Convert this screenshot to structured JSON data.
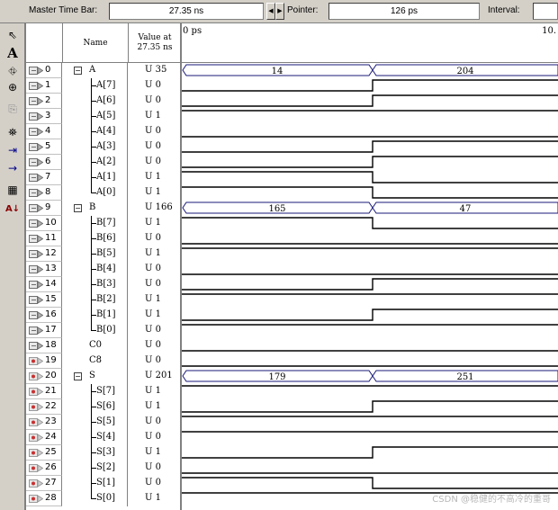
{
  "topbar": {
    "master_time_bar_label": "Master Time Bar:",
    "master_time_bar_value": "27.35 ns",
    "pointer_label": "Pointer:",
    "pointer_value": "126 ps",
    "interval_label": "Interval:",
    "interval_value": ""
  },
  "toolbar": {
    "tools": [
      "selection-tool-icon",
      "text-tool-icon",
      "waveform-editing-tool-icon",
      "zoom-tool-icon",
      "copy-icon",
      "find-icon",
      "replace-icon",
      "next-transition-icon",
      "group-icon",
      "sort-icon"
    ]
  },
  "grid": {
    "header_name": "Name",
    "header_value": "Value at\n27.35 ns"
  },
  "timeline": {
    "start_label": "0 ps",
    "end_label": "10."
  },
  "signals": [
    {
      "id": "0",
      "name": "A",
      "group": true,
      "value": "U 35",
      "pin": "input",
      "wave": "bus",
      "values": [
        "14",
        "204"
      ]
    },
    {
      "id": "1",
      "name": "A[7]",
      "value": "U 0",
      "pin": "input",
      "wave": "bit",
      "levels": [
        0,
        1
      ]
    },
    {
      "id": "2",
      "name": "A[6]",
      "value": "U 0",
      "pin": "input",
      "wave": "bit",
      "levels": [
        0,
        1
      ]
    },
    {
      "id": "3",
      "name": "A[5]",
      "value": "U 1",
      "pin": "input",
      "wave": "bit",
      "levels": [
        1,
        1
      ]
    },
    {
      "id": "4",
      "name": "A[4]",
      "value": "U 0",
      "pin": "input",
      "wave": "bit",
      "levels": [
        0,
        0
      ]
    },
    {
      "id": "5",
      "name": "A[3]",
      "value": "U 0",
      "pin": "input",
      "wave": "bit",
      "levels": [
        0,
        1
      ]
    },
    {
      "id": "6",
      "name": "A[2]",
      "value": "U 0",
      "pin": "input",
      "wave": "bit",
      "levels": [
        0,
        1
      ]
    },
    {
      "id": "7",
      "name": "A[1]",
      "value": "U 1",
      "pin": "input",
      "wave": "bit",
      "levels": [
        1,
        0
      ]
    },
    {
      "id": "8",
      "name": "A[0]",
      "value": "U 1",
      "pin": "input",
      "wave": "bit",
      "levels": [
        1,
        0
      ]
    },
    {
      "id": "9",
      "name": "B",
      "group": true,
      "value": "U 166",
      "pin": "input",
      "wave": "bus",
      "values": [
        "165",
        "47"
      ]
    },
    {
      "id": "10",
      "name": "B[7]",
      "value": "U 1",
      "pin": "input",
      "wave": "bit",
      "levels": [
        1,
        0
      ]
    },
    {
      "id": "11",
      "name": "B[6]",
      "value": "U 0",
      "pin": "input",
      "wave": "bit",
      "levels": [
        0,
        0
      ]
    },
    {
      "id": "12",
      "name": "B[5]",
      "value": "U 1",
      "pin": "input",
      "wave": "bit",
      "levels": [
        1,
        1
      ]
    },
    {
      "id": "13",
      "name": "B[4]",
      "value": "U 0",
      "pin": "input",
      "wave": "bit",
      "levels": [
        0,
        0
      ]
    },
    {
      "id": "14",
      "name": "B[3]",
      "value": "U 0",
      "pin": "input",
      "wave": "bit",
      "levels": [
        0,
        1
      ]
    },
    {
      "id": "15",
      "name": "B[2]",
      "value": "U 1",
      "pin": "input",
      "wave": "bit",
      "levels": [
        1,
        1
      ]
    },
    {
      "id": "16",
      "name": "B[1]",
      "value": "U 1",
      "pin": "input",
      "wave": "bit",
      "levels": [
        0,
        1
      ]
    },
    {
      "id": "17",
      "name": "B[0]",
      "value": "U 0",
      "pin": "input",
      "wave": "bit",
      "levels": [
        1,
        1
      ]
    },
    {
      "id": "18",
      "name": "C0",
      "value": "U 0",
      "pin": "input",
      "wave": "bit",
      "levels": [
        0,
        0
      ]
    },
    {
      "id": "19",
      "name": "C8",
      "value": "U 0",
      "pin": "output",
      "wave": "bit",
      "levels": [
        0,
        0
      ]
    },
    {
      "id": "20",
      "name": "S",
      "group": true,
      "value": "U 201",
      "pin": "output",
      "wave": "bus",
      "values": [
        "179",
        "251"
      ]
    },
    {
      "id": "21",
      "name": "S[7]",
      "value": "U 1",
      "pin": "output",
      "wave": "bit",
      "levels": [
        1,
        1
      ]
    },
    {
      "id": "22",
      "name": "S[6]",
      "value": "U 1",
      "pin": "output",
      "wave": "bit",
      "levels": [
        0,
        1
      ]
    },
    {
      "id": "23",
      "name": "S[5]",
      "value": "U 0",
      "pin": "output",
      "wave": "bit",
      "levels": [
        1,
        1
      ]
    },
    {
      "id": "24",
      "name": "S[4]",
      "value": "U 0",
      "pin": "output",
      "wave": "bit",
      "levels": [
        1,
        1
      ]
    },
    {
      "id": "25",
      "name": "S[3]",
      "value": "U 1",
      "pin": "output",
      "wave": "bit",
      "levels": [
        0,
        1
      ]
    },
    {
      "id": "26",
      "name": "S[2]",
      "value": "U 0",
      "pin": "output",
      "wave": "bit",
      "levels": [
        0,
        0
      ]
    },
    {
      "id": "27",
      "name": "S[1]",
      "value": "U 0",
      "pin": "output",
      "wave": "bit",
      "levels": [
        1,
        0
      ]
    },
    {
      "id": "28",
      "name": "S[0]",
      "value": "U 1",
      "pin": "output",
      "wave": "bit",
      "levels": [
        1,
        1
      ]
    }
  ],
  "colors": {
    "bus_outline": "#1a1a7a",
    "wave_line": "#000000",
    "background": "#d4d0c8"
  },
  "watermark": "CSDN @稳健的不高冷的重哥"
}
